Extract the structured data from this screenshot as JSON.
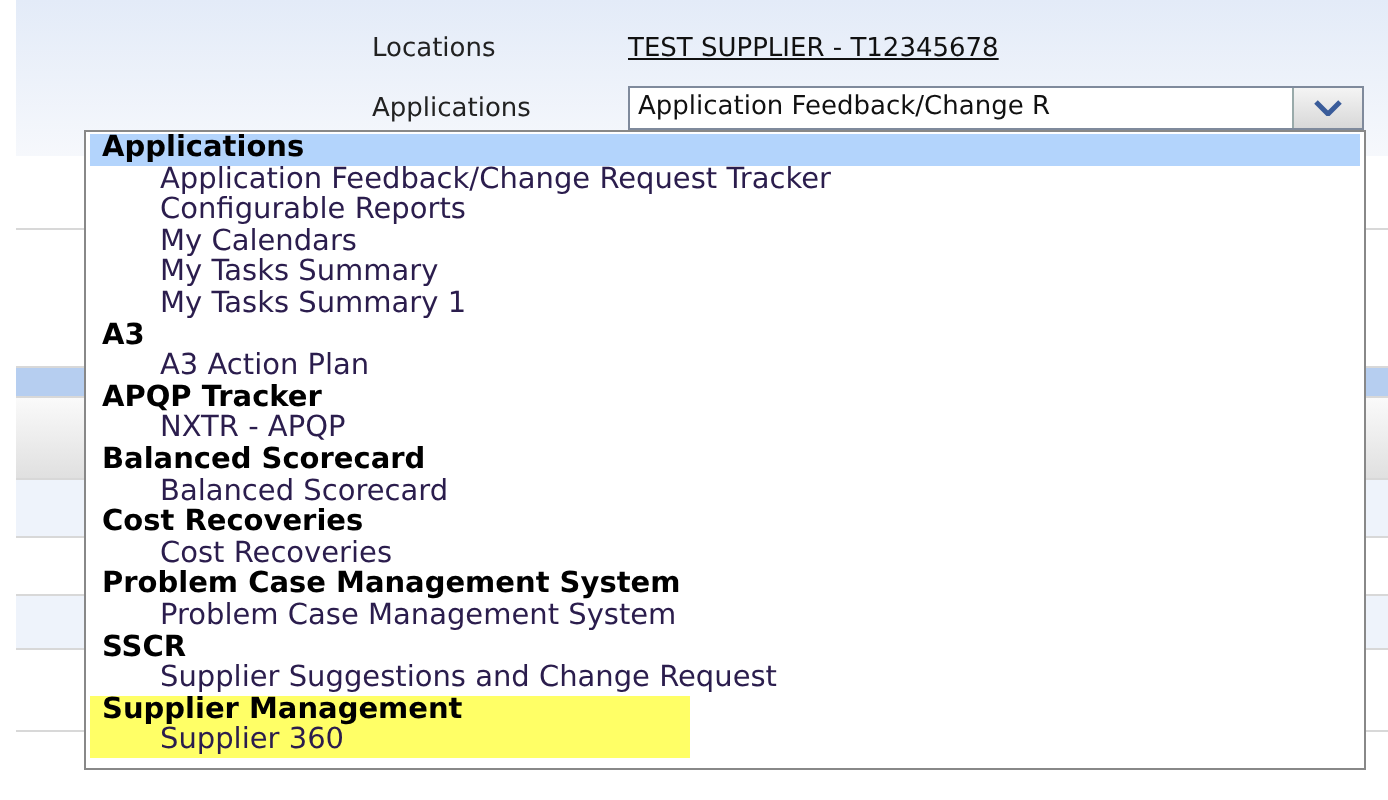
{
  "locations": {
    "label": "Locations",
    "value": "TEST SUPPLIER - T12345678"
  },
  "applications": {
    "label": "Applications",
    "value": "Application Feedback/Change R"
  },
  "dropdown_groups": [
    {
      "name": "Applications",
      "hovered": true,
      "highlighted": false,
      "items": [
        "Application Feedback/Change Request Tracker",
        "Configurable Reports",
        "My Calendars",
        "My Tasks Summary",
        "My Tasks Summary 1"
      ]
    },
    {
      "name": "A3",
      "hovered": false,
      "highlighted": false,
      "items": [
        "A3 Action Plan"
      ]
    },
    {
      "name": "APQP Tracker",
      "hovered": false,
      "highlighted": false,
      "items": [
        "NXTR - APQP"
      ]
    },
    {
      "name": "Balanced Scorecard",
      "hovered": false,
      "highlighted": false,
      "items": [
        "Balanced Scorecard"
      ]
    },
    {
      "name": "Cost Recoveries",
      "hovered": false,
      "highlighted": false,
      "items": [
        "Cost Recoveries"
      ]
    },
    {
      "name": "Problem Case Management System",
      "hovered": false,
      "highlighted": false,
      "items": [
        "Problem Case Management System"
      ]
    },
    {
      "name": "SSCR",
      "hovered": false,
      "highlighted": false,
      "items": [
        "Supplier Suggestions and Change Request"
      ]
    },
    {
      "name": "Supplier Management",
      "hovered": false,
      "highlighted": true,
      "items": [
        "Supplier 360"
      ]
    }
  ]
}
